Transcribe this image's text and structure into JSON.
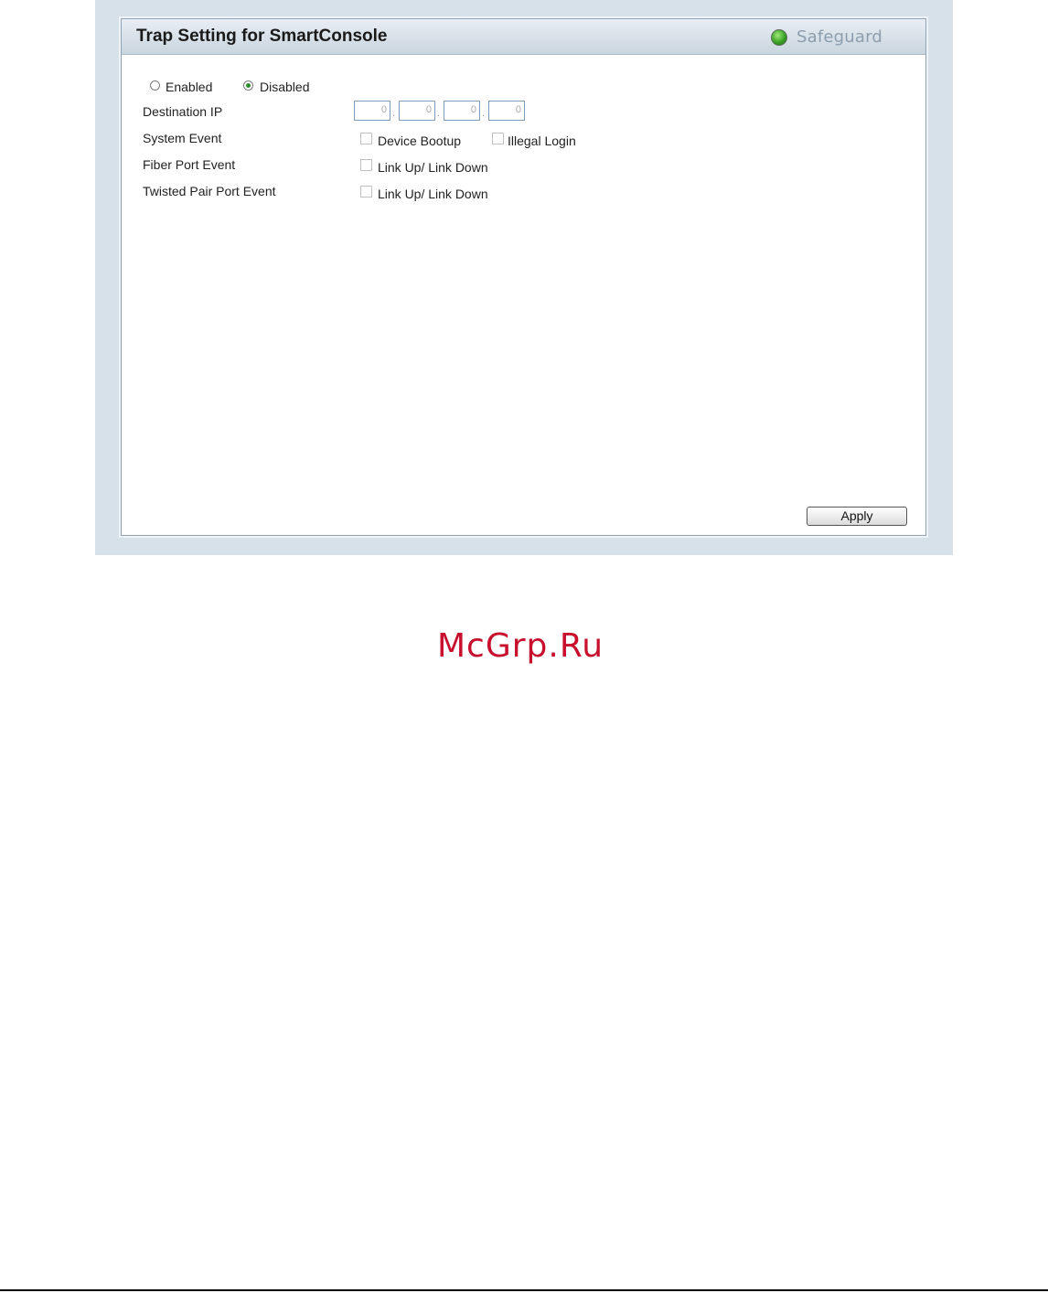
{
  "panel": {
    "title": "Trap Setting for SmartConsole",
    "safeguard_label": "Safeguard"
  },
  "state": {
    "options": [
      "Enabled",
      "Disabled"
    ],
    "selected": "Disabled"
  },
  "form": {
    "destination_ip_label": "Destination IP",
    "ip_octets": [
      "0",
      "0",
      "0",
      "0"
    ],
    "system_event_label": "System Event",
    "device_bootup_label": "Device Bootup",
    "illegal_login_label": "Illegal Login",
    "fiber_port_event_label": "Fiber Port Event",
    "fiber_link_label": "Link Up/ Link Down",
    "twisted_pair_event_label": "Twisted Pair Port Event",
    "twisted_link_label": "Link Up/ Link Down"
  },
  "apply_label": "Apply",
  "watermark": "McGrp.Ru",
  "colors": {
    "frame": "#d7e1ea",
    "panel_border": "#8fa3b5",
    "safeguard_green": "#3aa225",
    "watermark_red": "#c8102e"
  }
}
